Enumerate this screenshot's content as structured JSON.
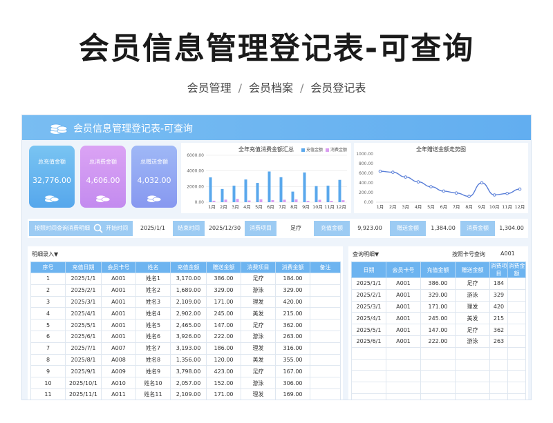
{
  "page": {
    "title": "会员信息管理登记表-可查询",
    "breadcrumb": [
      "会员管理",
      "会员档案",
      "会员登记表"
    ],
    "separator": "/"
  },
  "sheet": {
    "title": "会员信息管理登记表-可查询",
    "icon": "coins-icon",
    "cards": [
      {
        "label": "总充值金额",
        "value": "32,776.00",
        "color": "#62aef0"
      },
      {
        "label": "总消费金额",
        "value": "4,606.00",
        "color": "#c98ff0"
      },
      {
        "label": "总赠送金额",
        "value": "4,032.00",
        "color": "#8d9ef1"
      }
    ],
    "filter": {
      "search_label": "按照时间查询消费明细",
      "start_label": "开始时间",
      "start_value": "2025/1/1",
      "end_label": "结束时间",
      "end_value": "2025/12/30",
      "item_label": "消费项目",
      "item_value": "足疗",
      "recharge_label": "充值金额",
      "recharge_value": "9,923.00",
      "gift_label": "赠送金额",
      "gift_value": "1,384.00",
      "consume_label": "消费金额",
      "consume_value": "1,304.00"
    },
    "left_table": {
      "caption": "明细录入▼",
      "headers": [
        "序号",
        "充值日期",
        "会员卡号",
        "姓名",
        "充值金额",
        "赠送金额",
        "消费项目",
        "消费金额",
        "备注"
      ],
      "rows": [
        [
          "1",
          "2025/1/1",
          "A001",
          "姓名1",
          "3,170.00",
          "386.00",
          "足疗",
          "184.00",
          ""
        ],
        [
          "2",
          "2025/2/1",
          "A001",
          "姓名2",
          "1,689.00",
          "329.00",
          "游泳",
          "329.00",
          ""
        ],
        [
          "3",
          "2025/3/1",
          "A001",
          "姓名3",
          "2,109.00",
          "171.00",
          "理发",
          "420.00",
          ""
        ],
        [
          "4",
          "2025/4/1",
          "A001",
          "姓名4",
          "2,902.00",
          "245.00",
          "美发",
          "215.00",
          ""
        ],
        [
          "5",
          "2025/5/1",
          "A001",
          "姓名5",
          "2,465.00",
          "147.00",
          "足疗",
          "362.00",
          ""
        ],
        [
          "6",
          "2025/6/1",
          "A001",
          "姓名6",
          "3,926.00",
          "222.00",
          "游泳",
          "263.00",
          ""
        ],
        [
          "7",
          "2025/7/1",
          "A007",
          "姓名7",
          "3,193.00",
          "186.00",
          "理发",
          "316.00",
          ""
        ],
        [
          "8",
          "2025/8/1",
          "A008",
          "姓名8",
          "1,356.00",
          "120.00",
          "美发",
          "355.00",
          ""
        ],
        [
          "9",
          "2025/9/1",
          "A009",
          "姓名9",
          "3,798.00",
          "423.00",
          "足疗",
          "167.00",
          ""
        ],
        [
          "10",
          "2025/10/1",
          "A010",
          "姓名10",
          "2,057.00",
          "152.00",
          "游泳",
          "306.00",
          ""
        ],
        [
          "11",
          "2025/11/1",
          "A011",
          "姓名11",
          "2,109.00",
          "171.00",
          "理发",
          "169.00",
          ""
        ]
      ]
    },
    "right_table": {
      "caption": "查询明细▼",
      "query_label": "按照卡号查询",
      "query_value": "A001",
      "headers": [
        "日期",
        "会员卡号",
        "充值金额",
        "赠送金额",
        "消费项目",
        "消费金额"
      ],
      "rows": [
        [
          "2025/1/1",
          "A001",
          "386.00",
          "足疗",
          "184"
        ],
        [
          "2025/2/1",
          "A001",
          "329.00",
          "游泳",
          "329"
        ],
        [
          "2025/3/1",
          "A001",
          "171.00",
          "理发",
          "420"
        ],
        [
          "2025/4/1",
          "A001",
          "245.00",
          "美发",
          "215"
        ],
        [
          "2025/5/1",
          "A001",
          "147.00",
          "足疗",
          "362"
        ],
        [
          "2025/6/1",
          "A001",
          "222.00",
          "游泳",
          "263"
        ]
      ]
    }
  },
  "chart_data": [
    {
      "type": "bar",
      "title": "全年充值消费金额汇总",
      "categories": [
        "1月",
        "2月",
        "3月",
        "4月",
        "5月",
        "6月",
        "7月",
        "8月",
        "9月",
        "10月",
        "11月",
        "12月"
      ],
      "ylim": [
        0,
        6000
      ],
      "yticks": [
        "0.00",
        "2000.00",
        "4000.00",
        "6000.00"
      ],
      "series": [
        {
          "name": "充值金额",
          "color": "#5aa8ec",
          "values": [
            3170,
            1689,
            2109,
            2902,
            2465,
            3926,
            3193,
            1356,
            3798,
            2057,
            2109,
            2850
          ]
        },
        {
          "name": "消费金额",
          "color": "#d99cf0",
          "values": [
            184,
            329,
            420,
            215,
            362,
            263,
            316,
            355,
            167,
            306,
            169,
            250
          ]
        }
      ]
    },
    {
      "type": "line",
      "title": "全年赠送金额走势图",
      "categories": [
        "1月",
        "2月",
        "3月",
        "4月",
        "5月",
        "6月",
        "7月",
        "8月",
        "9月",
        "10月",
        "11月",
        "12月"
      ],
      "ylim": [
        0,
        1000
      ],
      "yticks": [
        "0.00",
        "200.00",
        "400.00",
        "600.00",
        "800.00",
        "1000.00"
      ],
      "series": [
        {
          "name": "赠送金额",
          "color": "#5a7fd8",
          "values": [
            640,
            620,
            520,
            420,
            320,
            230,
            190,
            120,
            400,
            150,
            180,
            270
          ]
        }
      ]
    }
  ]
}
